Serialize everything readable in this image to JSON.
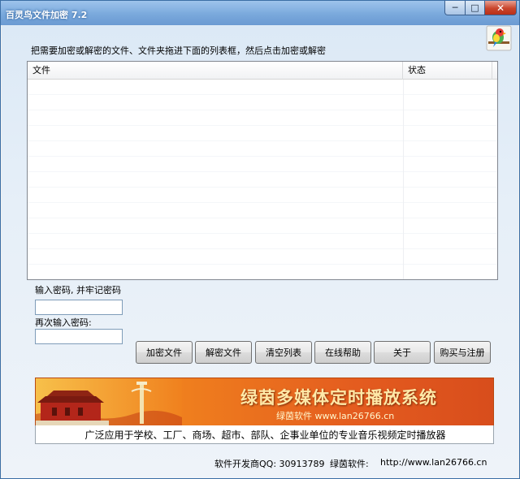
{
  "window": {
    "title": "百灵鸟文件加密 7.2",
    "min_glyph": "─",
    "max_glyph": "□",
    "close_glyph": "✕"
  },
  "instruction": "把需要加密或解密的文件、文件夹拖进下面的列表框，然后点击加密或解密",
  "list": {
    "columns": [
      "文件",
      "状态"
    ]
  },
  "password": {
    "label1": "输入密码, 并牢记密码",
    "value1": "",
    "label2": "再次输入密码:",
    "value2": ""
  },
  "buttons": {
    "encrypt": "加密文件",
    "decrypt": "解密文件",
    "clear": "清空列表",
    "help": "在线帮助",
    "about": "关于",
    "buy": "购买与注册"
  },
  "banner": {
    "title": "绿茵多媒体定时播放系统",
    "url_line": "绿茵软件 www.lan26766.cn",
    "subtitle": "广泛应用于学校、工厂、商场、超市、部队、企事业单位的专业音乐视频定时播放器"
  },
  "footer": {
    "qq": "软件开发商QQ: 30913789",
    "brand": "绿茵软件:",
    "url": "http://www.lan26766.cn"
  },
  "colors": {
    "title_bar": "#7aa9dc",
    "banner_orange": "#f0811e",
    "close_red": "#c9452c"
  }
}
